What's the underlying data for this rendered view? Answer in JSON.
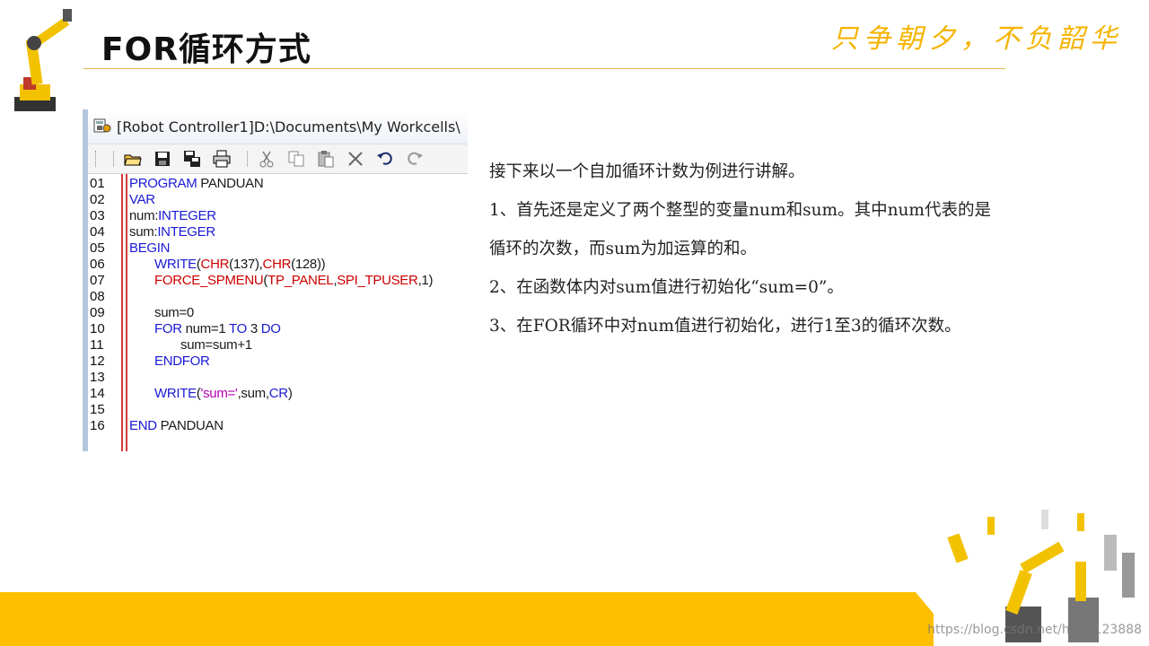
{
  "slide": {
    "title": "FOR循环方式",
    "slogan": "只争朝夕，不负韶华",
    "watermark": "https://blog.csdn.net/haier123888"
  },
  "editor": {
    "window_title": "[Robot Controller1]D:\\Documents\\My Workcells\\",
    "toolbar_icons": [
      "open-folder-icon",
      "save-icon",
      "save-as-icon",
      "print-icon",
      "cut-icon",
      "copy-icon",
      "paste-icon",
      "delete-icon",
      "undo-icon",
      "redo-icon"
    ],
    "line_numbers": [
      "01",
      "02",
      "03",
      "04",
      "05",
      "06",
      "07",
      "08",
      "09",
      "10",
      "11",
      "12",
      "13",
      "14",
      "15",
      "16"
    ],
    "code": {
      "l1_kw": "PROGRAM",
      "l1_rest": " PANDUAN",
      "l2_kw": "VAR",
      "l3_a": "num:",
      "l3_b": "INTEGER",
      "l4_a": "sum:",
      "l4_b": "INTEGER",
      "l5_kw": "BEGIN",
      "l6_write": "WRITE",
      "l6_p1": "(",
      "l6_chr1": "CHR",
      "l6_p2": "(137),",
      "l6_chr2": "CHR",
      "l6_p3": "(128))",
      "l7_fn": "FORCE_SPMENU",
      "l7_p1": "(",
      "l7_a": "TP_PANEL",
      "l7_c1": ",",
      "l7_b": "SPI_TPUSER",
      "l7_p2": ",1)",
      "l9": "sum=0",
      "l10_for": "FOR",
      "l10_mid": " num=1 ",
      "l10_to": "TO",
      "l10_3": " 3 ",
      "l10_do": "DO",
      "l11": "sum=sum+1",
      "l12_kw": "ENDFOR",
      "l14_write": "WRITE",
      "l14_p1": "(",
      "l14_str": "'sum='",
      "l14_mid": ",sum,",
      "l14_cr": "CR",
      "l14_p2": ")",
      "l16_kw": "END",
      "l16_rest": " PANDUAN"
    },
    "colors": {
      "keyword": "#1a1ad6",
      "function": "#cc0000",
      "string": "#b000b0",
      "gutter_line": "#d43a3a"
    }
  },
  "explanation": {
    "p1": "接下来以一个自加循环计数为例进行讲解。",
    "p2": "1、首先还是定义了两个整型的变量num和sum。其中num代表的是循环的次数，而sum为加运算的和。",
    "p3": "2、在函数体内对sum值进行初始化“sum=0”。",
    "p4": "3、在FOR循环中对num值进行初始化，进行1至3的循环次数。"
  },
  "colors": {
    "accent": "#fdbf00",
    "slogan": "#f5b400"
  }
}
